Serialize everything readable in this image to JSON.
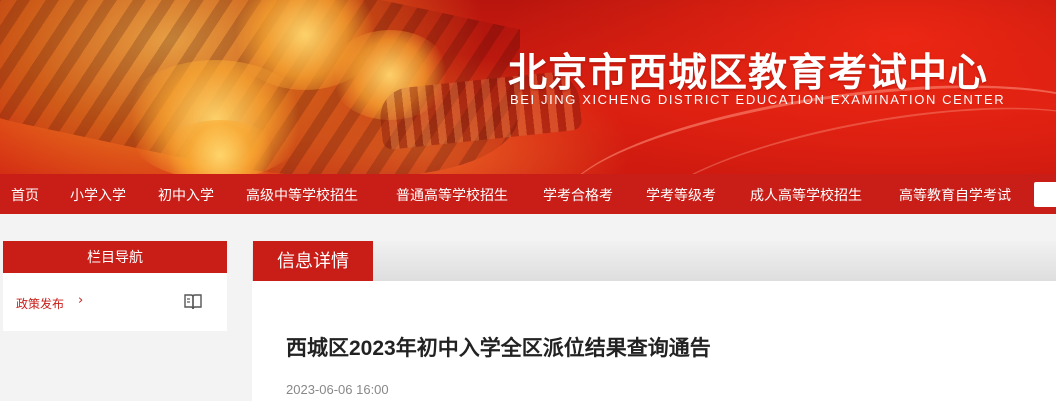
{
  "banner": {
    "title": "北京市西城区教育考试中心",
    "subtitle": "BEI JING XICHENG DISTRICT EDUCATION EXAMINATION  CENTER"
  },
  "nav": {
    "items": [
      {
        "label": "首页"
      },
      {
        "label": "小学入学"
      },
      {
        "label": "初中入学"
      },
      {
        "label": "高级中等学校招生"
      },
      {
        "label": "普通高等学校招生"
      },
      {
        "label": "学考合格考"
      },
      {
        "label": "学考等级考"
      },
      {
        "label": "成人高等学校招生"
      },
      {
        "label": "高等教育自学考试"
      }
    ]
  },
  "sidebar": {
    "header": "栏目导航",
    "items": [
      {
        "label": "政策发布",
        "icon": "book-icon"
      }
    ]
  },
  "main": {
    "tab_label": "信息详情",
    "article": {
      "title": "西城区2023年初中入学全区派位结果查询通告",
      "date": "2023-06-06 16:00"
    }
  },
  "colors": {
    "brand_red": "#c91d17",
    "background": "#f3f3f3"
  }
}
